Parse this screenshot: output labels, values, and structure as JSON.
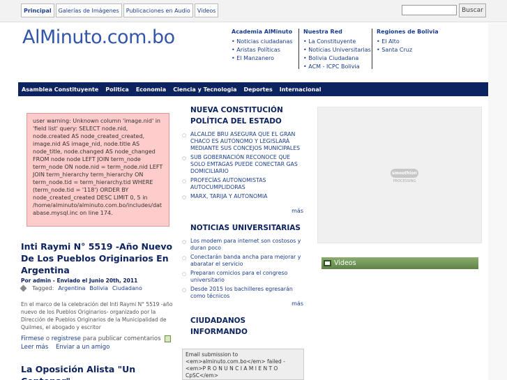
{
  "topnav": {
    "items": [
      {
        "label": "Principal",
        "active": true
      },
      {
        "label": "Galerías de Imágenes"
      },
      {
        "label": "Publicaciones en Audio"
      },
      {
        "label": "Videos"
      }
    ],
    "search_button": "Buscar",
    "search_value": ""
  },
  "header": {
    "logo": "AlMinuto.com.bo",
    "columns": [
      {
        "title": "Academia AlMinuto",
        "items": [
          "Noticias ciudadanas",
          "Aristas Políticas",
          "El Manzanero"
        ]
      },
      {
        "title": "Nuestra Red",
        "items": [
          "La Constituyente",
          "Noticias Universitarias",
          "Bolivia Ciudadana",
          "ACM - ICPC Bolivia"
        ]
      },
      {
        "title": "Regiones de Bolivia",
        "items": [
          "El Alto",
          "Santa Cruz"
        ]
      }
    ]
  },
  "mainnav": [
    "Asamblea Constituyente",
    "Politica",
    "Economia",
    "Ciencia y Tecnologia",
    "Deportes",
    "Internacional"
  ],
  "warning": "user warning: Unknown column 'image.nid' in 'field list' query: SELECT node.nid, node.created AS node_created_created, image.nid AS image_nid, node.title AS node_title, node.changed AS node_changed FROM node node LEFT JOIN term_node term_node ON node.nid = term_node.nid LEFT JOIN term_hierarchy term_hierarchy ON term_node.tid = term_hierarchy.tid WHERE (term_node.tid = '118') ORDER BY node_created_created DESC LIMIT 0, 5 in /home/alminuto/alminuto.com.bo/includes/database.mysql.inc on line 174.",
  "posts": [
    {
      "title": "Inti Raymi N° 5519 -Año Nuevo De Los Pueblos Originarios En Argentina",
      "meta": "Por admin - Enviado el Junio 20th, 2011",
      "tags_label": "Tagged:",
      "tags": [
        "Argentina",
        "Bolivia",
        "Ciudadano"
      ],
      "body": "En el marco de la celebración del Inti Raymi N° 5519 -año nuevo de los Pueblos Originarios- organizado por la Dirección de Pueblos Originarios de la Municipalidad de Quilmes, el abogado y escritor",
      "login": "Firmese",
      "or": "o",
      "register": "registrese",
      "comment_text": "para publicar comentarios",
      "read_more": "Leer más",
      "send_friend": "Enviar a un amigo"
    },
    {
      "title": "La Oposición Alista \"Un Centenar\""
    }
  ],
  "mid": {
    "sections": [
      {
        "title": "NUEVA CONSTITUCIÓN POLÍTICA DEL ESTADO",
        "items": [
          "ALCALDE BRU ASEGURA QUE EL GRAN CHACO ES AUTÓNOMO Y LEGISLARÁ MEDIANTE SUS CONCEJOS MUNICIPALES",
          "SUB GOBERNACIÓN RECONOCE QUE SOLO EMTAGAS PUEDE CONECTAR GAS DOMICILIARIO",
          "PROFECÍAS AUTONOMISTAS AUTOCUMPLIDORAS",
          "MARX, TARIJA Y AUTONOMIA"
        ],
        "more": "más"
      },
      {
        "title": "NOTICIAS UNIVERSITARIAS",
        "items": [
          "Los modem para internet son costosos y duran poco",
          "Conectarán banda ancha para mejorar y abaratar el servicio",
          "Preparan comicios para el congreso universitario",
          "Desde 2015 los bachilleres egresarán como técnicos"
        ],
        "more": "más"
      },
      {
        "title": "CIUDADANOS INFORMANDO"
      }
    ],
    "email_notice": "Email submission to <em>alminuto.com.bo</em> failed - <em>P R O N U N C I A M I E N T O CpSC</em>"
  },
  "right": {
    "player_logo": "smoothion",
    "player_status": "PROCESSING",
    "videos_title": "Videos"
  },
  "colors": {
    "nav_bg": "#0d2360",
    "link": "#1a3c8c",
    "logo": "#3355aa",
    "warning_bg": "#ffcccc",
    "videos_header": "#6b9252"
  }
}
